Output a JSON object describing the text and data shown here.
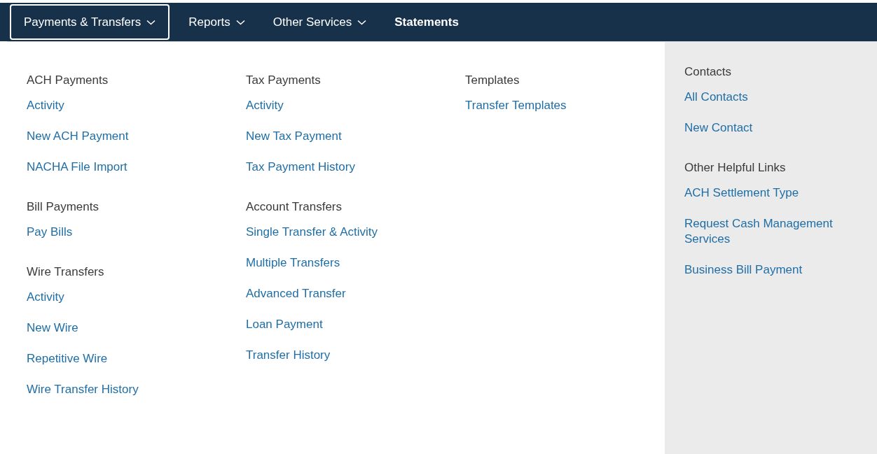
{
  "nav": {
    "tabs": [
      {
        "label": "Payments & Transfers",
        "has_menu": true,
        "selected": true
      },
      {
        "label": "Reports",
        "has_menu": true,
        "selected": false
      },
      {
        "label": "Other Services",
        "has_menu": true,
        "selected": false
      },
      {
        "label": "Statements",
        "has_menu": false,
        "selected": false
      }
    ]
  },
  "menu": {
    "columns": [
      {
        "kind": "main",
        "groups": [
          {
            "heading": "ACH Payments",
            "links": [
              "Activity",
              "New ACH Payment",
              "NACHA File Import"
            ]
          },
          {
            "heading": "Bill Payments",
            "links": [
              "Pay Bills"
            ]
          },
          {
            "heading": "Wire Transfers",
            "links": [
              "Activity",
              "New Wire",
              "Repetitive Wire",
              "Wire Transfer History"
            ]
          }
        ]
      },
      {
        "kind": "main",
        "groups": [
          {
            "heading": "Tax Payments",
            "links": [
              "Activity",
              "New Tax Payment",
              "Tax Payment History"
            ]
          },
          {
            "heading": "Account Transfers",
            "links": [
              "Single Transfer & Activity",
              "Multiple Transfers",
              "Advanced Transfer",
              "Loan Payment",
              "Transfer History"
            ]
          }
        ]
      },
      {
        "kind": "main",
        "groups": [
          {
            "heading": "Templates",
            "links": [
              "Transfer Templates"
            ]
          }
        ]
      },
      {
        "kind": "side",
        "groups": [
          {
            "heading": "Contacts",
            "links": [
              "All Contacts",
              "New Contact"
            ]
          },
          {
            "heading": "Other Helpful Links",
            "links": [
              "ACH Settlement Type",
              "Request Cash Management Services",
              "Business Bill Payment"
            ]
          }
        ]
      }
    ]
  }
}
